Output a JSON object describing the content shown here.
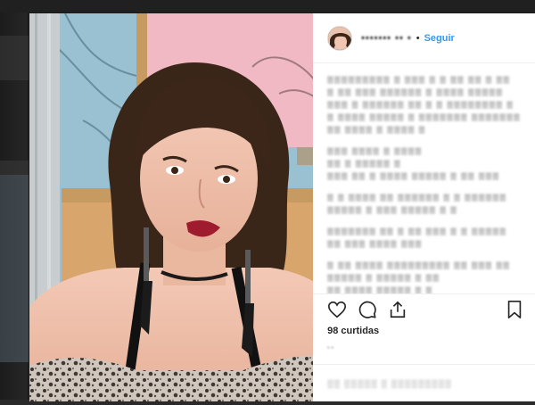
{
  "post": {
    "username": "••••••• •• •",
    "separator": "•",
    "follow_label": "Seguir",
    "likes": "98 curtidas",
    "time": "• •",
    "add_comment": "▒▒ ▒▒▒▒▒ ▒ ▒▒▒▒▒▒▒▒▒"
  },
  "comments": [
    "▒▒▒▒▒▒▒▒▒ ▒ ▒▒▒ ▒ ▒ ▒▒ ▒▒ ▒ ▒▒",
    "▒ ▒▒ ▒▒▒ ▒▒▒▒▒▒ ▒ ▒▒▒▒ ▒▒▒▒▒",
    "▒▒▒ ▒ ▒▒▒▒▒▒ ▒▒ ▒ ▒ ▒▒▒▒▒▒▒▒ ▒",
    "▒ ▒▒▒▒ ▒▒▒▒▒ ▒ ▒▒▒▒▒▒▒ ▒▒▒▒▒▒▒",
    "▒▒ ▒▒▒▒ ▒ ▒▒▒▒ ▒",
    "",
    "▒▒▒ ▒▒▒▒ ▒ ▒▒▒▒",
    "▒▒ ▒ ▒▒▒▒▒ ▒",
    "▒▒▒ ▒▒ ▒ ▒▒▒▒ ▒▒▒▒▒ ▒ ▒▒ ▒▒▒",
    "",
    "▒ ▒ ▒▒▒▒ ▒▒ ▒▒▒▒▒▒ ▒ ▒ ▒▒▒▒▒▒",
    "▒▒▒▒▒ ▒ ▒▒▒ ▒▒▒▒▒ ▒ ▒",
    "",
    "▒▒▒▒▒▒▒ ▒▒ ▒ ▒▒ ▒▒▒ ▒ ▒ ▒▒▒▒▒",
    "▒▒ ▒▒▒ ▒▒▒▒ ▒▒▒",
    "",
    "▒ ▒▒ ▒▒▒▒ ▒▒▒▒▒▒▒▒▒ ▒▒ ▒▒▒ ▒▒",
    "▒▒▒▒▒ ▒ ▒▒▒▒▒ ▒ ▒▒",
    "▒▒ ▒▒▒▒ ▒▒▒▒▒ ▒ ▒",
    "▒▒▒ ▒▒ ▒ ▒▒▒▒▒ ▒▒▒▒▒ ▒▒▒▒▒▒▒▒"
  ],
  "colors": {
    "follow_blue": "#3897f0",
    "panel_bg": "#ffffff",
    "backdrop": "#161616"
  },
  "icons": {
    "like": "heart-icon",
    "comment": "comment-icon",
    "share": "share-icon",
    "save": "bookmark-icon"
  }
}
